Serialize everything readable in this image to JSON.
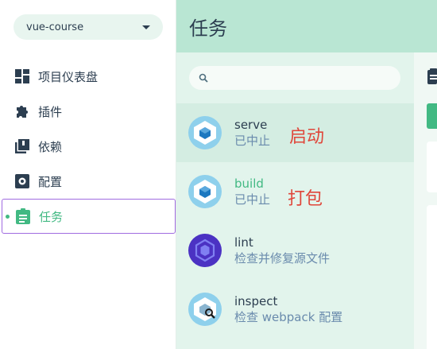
{
  "project": {
    "name": "vue-course"
  },
  "nav": [
    {
      "label": "项目仪表盘",
      "icon": "dashboard-icon"
    },
    {
      "label": "插件",
      "icon": "puzzle-icon"
    },
    {
      "label": "依赖",
      "icon": "library-books-icon"
    },
    {
      "label": "配置",
      "icon": "settings-icon"
    },
    {
      "label": "任务",
      "icon": "assignment-icon",
      "active": true
    }
  ],
  "header": {
    "title": "任务"
  },
  "search": {
    "placeholder": ""
  },
  "tasks": [
    {
      "name": "serve",
      "description": "已中止",
      "note": "启动",
      "icon": "webpack-icon"
    },
    {
      "name": "build",
      "description": "已中止",
      "note": "打包",
      "icon": "webpack-icon"
    },
    {
      "name": "lint",
      "description": "检查并修复源文件",
      "icon": "eslint-icon"
    },
    {
      "name": "inspect",
      "description": "检查 webpack 配置",
      "icon": "webpack-inspect-icon"
    }
  ],
  "colors": {
    "accent": "#42b983",
    "header_bg": "#b9e6d3",
    "list_bg": "#e2f4ec",
    "note_red": "#e0463a"
  }
}
